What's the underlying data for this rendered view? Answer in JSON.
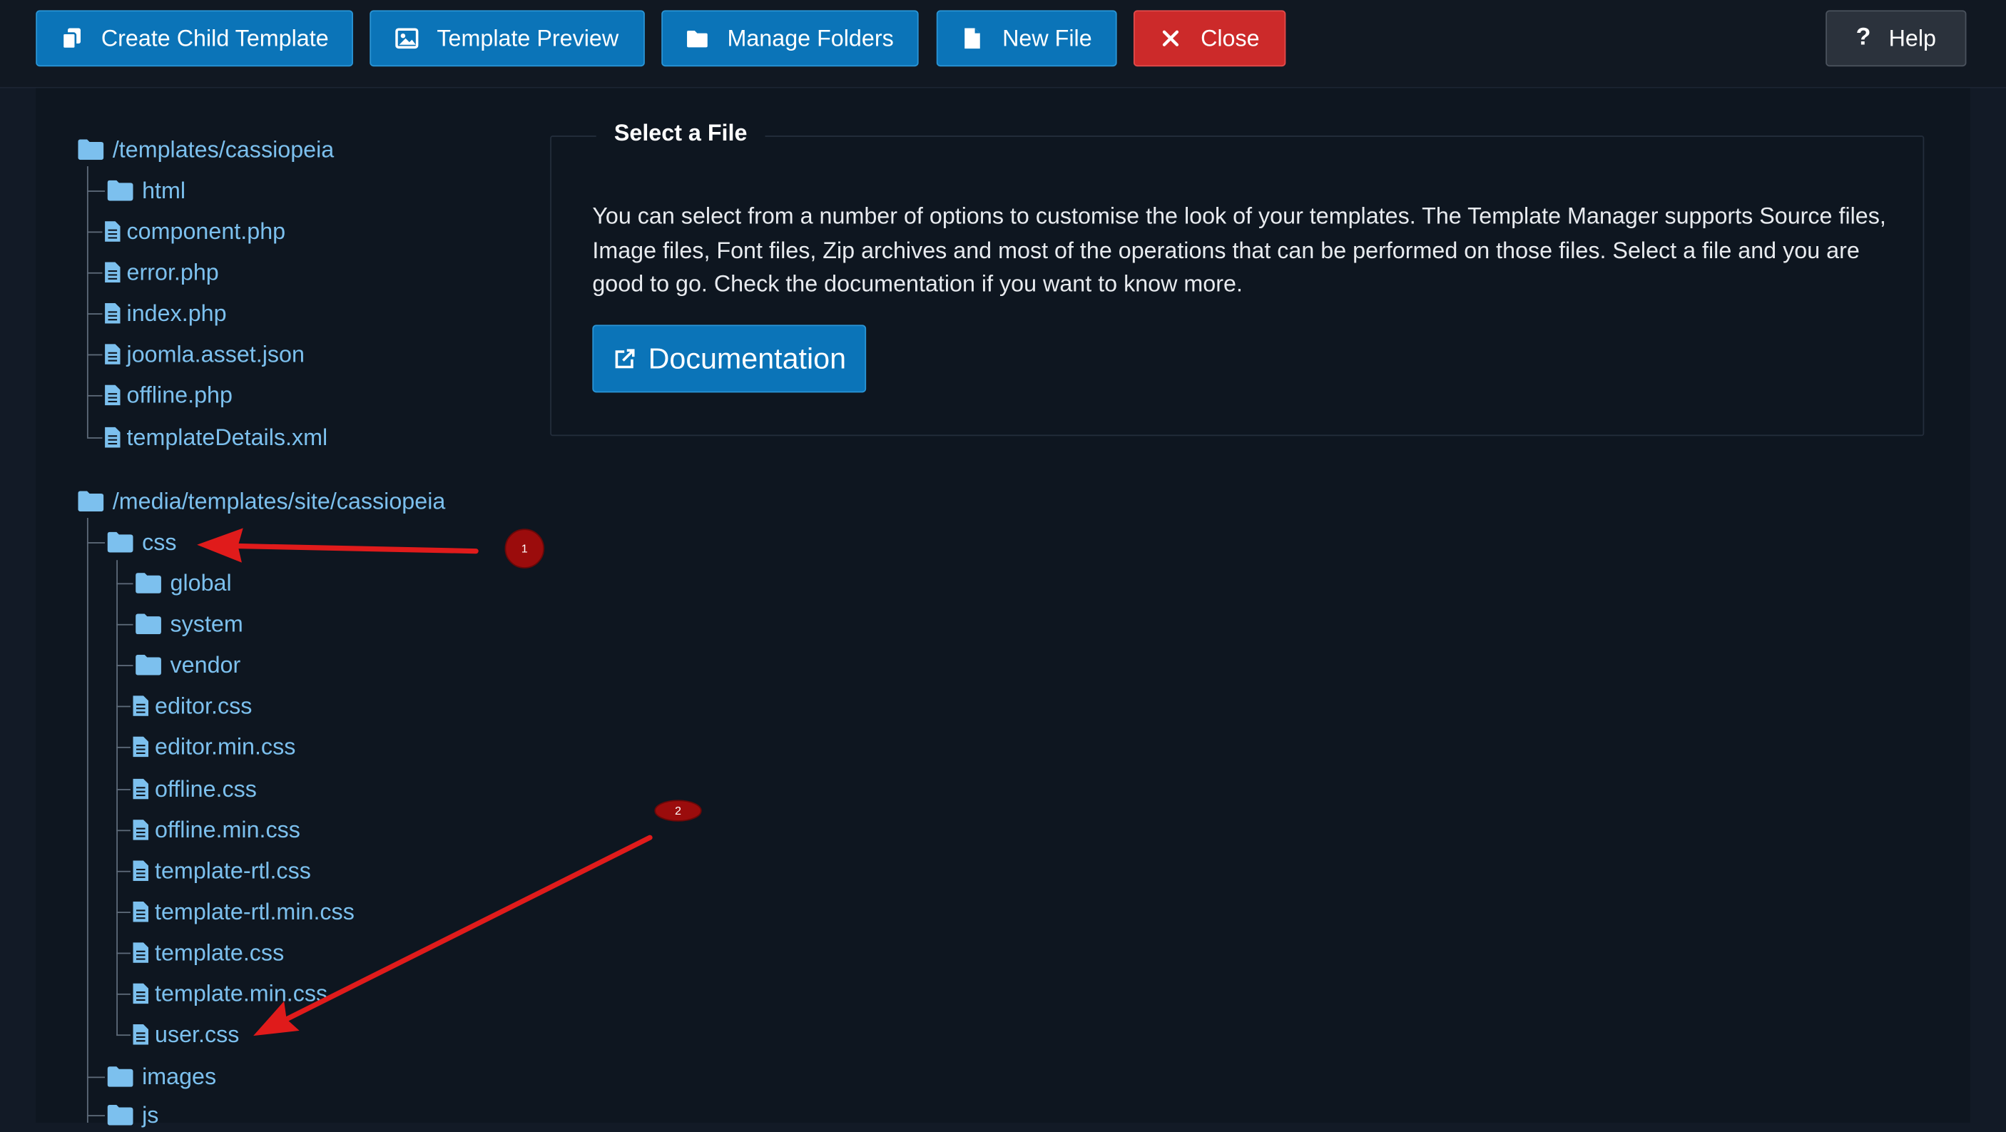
{
  "toolbar": {
    "create_child": "Create Child Template",
    "preview": "Template Preview",
    "manage_folders": "Manage Folders",
    "new_file": "New File",
    "close": "Close",
    "help": "Help"
  },
  "tree": {
    "root1": {
      "label": "/templates/cassiopeia",
      "folders": [
        "html"
      ],
      "files": [
        "component.php",
        "error.php",
        "index.php",
        "joomla.asset.json",
        "offline.php",
        "templateDetails.xml"
      ]
    },
    "root2": {
      "label": "/media/templates/site/cassiopeia",
      "css": "css",
      "css_folders": [
        "global",
        "system",
        "vendor"
      ],
      "css_files": [
        "editor.css",
        "editor.min.css",
        "offline.css",
        "offline.min.css",
        "template-rtl.css",
        "template-rtl.min.css",
        "template.css",
        "template.min.css",
        "user.css"
      ],
      "images": "images",
      "js": "js"
    }
  },
  "panel": {
    "legend": "Select a File",
    "description": "You can select from a number of options to customise the look of your templates. The Template Manager supports Source files, Image files, Font files, Zip archives and most of the operations that can be performed on those files. Select a file and you are good to go. Check the documentation if you want to know more.",
    "doc_button": "Documentation"
  },
  "annotations": {
    "badge1": "1",
    "badge2": "2",
    "arrow_color": "#e01b1b",
    "badge_color": "#9b0c0c"
  },
  "colors": {
    "toolbar_blue": "#0b74b8",
    "close_red": "#cc2a2a",
    "tree_link": "#7cc0ee",
    "background": "#121a26"
  }
}
